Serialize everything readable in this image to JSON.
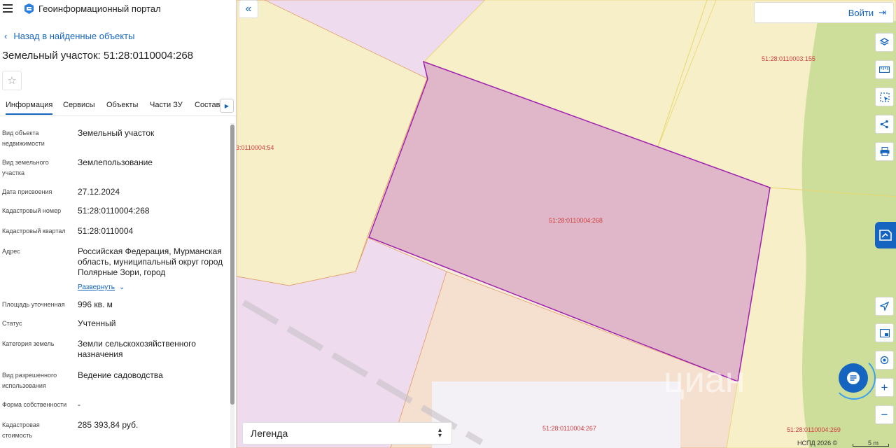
{
  "header": {
    "app_title": "Геоинформационный портал"
  },
  "panel": {
    "back_label": "Назад в найденные объекты",
    "object_title": "Земельный участок: 51:28:0110004:268",
    "tabs": [
      {
        "label": "Информация",
        "active": true
      },
      {
        "label": "Сервисы"
      },
      {
        "label": "Объекты"
      },
      {
        "label": "Части ЗУ"
      },
      {
        "label": "Состав"
      }
    ],
    "properties": [
      {
        "key": "Вид объекта недвижимости",
        "value": "Земельный участок"
      },
      {
        "key": "Вид земельного участка",
        "value": "Землепользование"
      },
      {
        "key": "Дата присвоения",
        "value": "27.12.2024"
      },
      {
        "key": "Кадастровый номер",
        "value": "51:28:0110004:268"
      },
      {
        "key": "Кадастровый квартал",
        "value": "51:28:0110004"
      },
      {
        "key": "Адрес",
        "value": "Российская Федерация, Мурманская область, муниципальный округ город Полярные Зори, город",
        "expand_label": "Развернуть"
      },
      {
        "key": "Площадь уточненная",
        "value": "996 кв. м"
      },
      {
        "key": "Статус",
        "value": "Учтенный"
      },
      {
        "key": "Категория земель",
        "value": "Земли сельскохозяйственного назначения"
      },
      {
        "key": "Вид разрешенного использования",
        "value": "Ведение садоводства"
      },
      {
        "key": "Форма собственности",
        "value": "-"
      },
      {
        "key": "Кадастровая стоимость",
        "value": "285 393,84 руб."
      }
    ]
  },
  "map": {
    "login_label": "Войти",
    "legend_label": "Легенда",
    "attribution": "НСПД 2026 ©",
    "scale_label": "5 m",
    "parcel_labels": {
      "selected": "51:28:0110004:268",
      "left": "3:0110004:54",
      "top_right": "51:28:0110003:155",
      "bottom": "51:28:0110004:267",
      "bottom_right": "51:28:0110004:269"
    },
    "watermark": "циан",
    "colors": {
      "selected_fill": "#e0b7c9",
      "selected_stroke": "#a020b0",
      "parcel_yellow": "#f7efc8",
      "parcel_pink": "#eedcee",
      "parcel_peach": "#f5e0cf",
      "vegetation": "#c7dc93",
      "label_red": "#d04040",
      "accent": "#1565c0"
    },
    "tools": [
      "layers-icon",
      "ruler-icon",
      "select-area-icon",
      "share-icon",
      "print-icon",
      "navigate-icon",
      "minimap-icon",
      "location-icon",
      "zoom-in-icon",
      "zoom-out-icon"
    ]
  }
}
